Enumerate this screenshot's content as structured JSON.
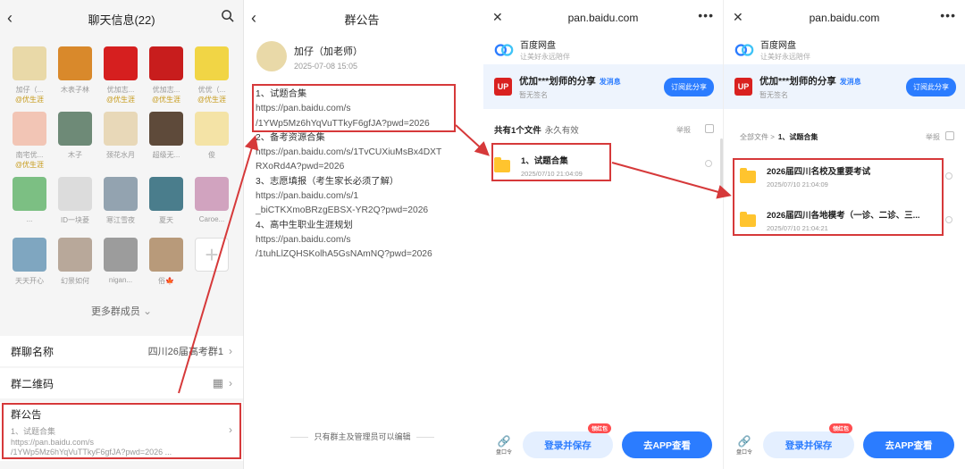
{
  "panel1": {
    "title": "聊天信息(22)",
    "members": [
      {
        "name": "加仔（...",
        "tag": "@优生涯",
        "bg": "#e9d9a8"
      },
      {
        "name": "木表子林",
        "tag": "",
        "bg": "#d9892b"
      },
      {
        "name": "优加志...",
        "tag": "@优生涯",
        "bg": "#d61f1f"
      },
      {
        "name": "优加志...",
        "tag": "@优生涯",
        "bg": "#c81d1d"
      },
      {
        "name": "优优（...",
        "tag": "@优生涯",
        "bg": "#f1d545"
      },
      {
        "name": "南宅优...",
        "tag": "@优生涯",
        "bg": "#f2c5b5"
      },
      {
        "name": "木子",
        "tag": "",
        "bg": "#6e8a77"
      },
      {
        "name": "颈花水月",
        "tag": "",
        "bg": "#e8d8b8"
      },
      {
        "name": "超级无...",
        "tag": "",
        "bg": "#5e4a3a"
      },
      {
        "name": "俊",
        "tag": "",
        "bg": "#f4e3a6"
      },
      {
        "name": "...",
        "tag": "",
        "bg": "#7cbf83"
      },
      {
        "name": "ID一块菱",
        "tag": "",
        "bg": "#dcdcdc"
      },
      {
        "name": "寒江雪夜",
        "tag": "",
        "bg": "#93a3b0"
      },
      {
        "name": "夏天",
        "tag": "",
        "bg": "#4a7d8c"
      },
      {
        "name": "Caroe...",
        "tag": "",
        "bg": "#d1a3bf"
      },
      {
        "name": "天天开心",
        "tag": "",
        "bg": "#7fa6c0"
      },
      {
        "name": "幻景如何",
        "tag": "",
        "bg": "#b8a89a"
      },
      {
        "name": "nigan...",
        "tag": "",
        "bg": "#9c9c9c"
      },
      {
        "name": "俗🍁",
        "tag": "",
        "bg": "#b89a7a"
      }
    ],
    "more_members": "更多群成员",
    "group_name_label": "群聊名称",
    "group_name_value": "四川26届高考群1",
    "qr_label": "群二维码",
    "notice_label": "群公告",
    "notice_preview_1": "1、试题合集",
    "notice_preview_2": "https://pan.baidu.com/s",
    "notice_preview_3": "/1YWp5Mz6hYqVuTTkyF6gfJA?pwd=2026 ..."
  },
  "panel2": {
    "title": "群公告",
    "author": "加仔（加老师）",
    "time": "2025-07-08 15:05",
    "items": [
      {
        "t": "1、试题合集",
        "u1": "https://pan.baidu.com/s",
        "u2": "/1YWp5Mz6hYqVuTTkyF6gfJA?pwd=2026"
      },
      {
        "t": "2、备考资源合集",
        "u1": "https://pan.baidu.com/s/1TvCUXiuMsBx4DXT",
        "u2": "RXoRd4A?pwd=2026"
      },
      {
        "t": "3、志愿填报（考生家长必须了解）",
        "u1": "https://pan.baidu.com/s/1",
        "u2": "_biCTKXmoBRzgEBSX-YR2Q?pwd=2026"
      },
      {
        "t": "4、高中生职业生涯规划",
        "u1": "https://pan.baidu.com/s",
        "u2": "/1tuhLlZQHSKolhA5GsNAmNQ?pwd=2026"
      }
    ],
    "footer": "只有群主及管理员可以编辑"
  },
  "baidu": {
    "domain": "pan.baidu.com",
    "brand": "百度网盘",
    "slogan": "让美好永远陪伴",
    "share_title": "优加***划师的分享",
    "share_msg": "发消息",
    "share_sub": "暂无签名",
    "subscribe": "订阅此分享",
    "report": "举报",
    "link_label": "盘口令",
    "login_save": "登录并保存",
    "badge": "领红包",
    "go_app": "去APP查看"
  },
  "panel3": {
    "count": "共有1个文件",
    "valid": "永久有效",
    "file_name": "1、试题合集",
    "file_date": "2025/07/10 21:04:09"
  },
  "panel4": {
    "crumb_all": "全部文件",
    "crumb_sep": ">",
    "crumb_cur": "1、试题合集",
    "files": [
      {
        "name": "2026届四川名校及重要考试",
        "date": "2025/07/10 21:04:09"
      },
      {
        "name": "2026届四川各地模考（一诊、二诊、三...",
        "date": "2025/07/10 21:04:21"
      }
    ]
  },
  "colors": {
    "accent": "#2b7cff",
    "highlight": "#d6393a",
    "folder": "#ffc42e"
  }
}
